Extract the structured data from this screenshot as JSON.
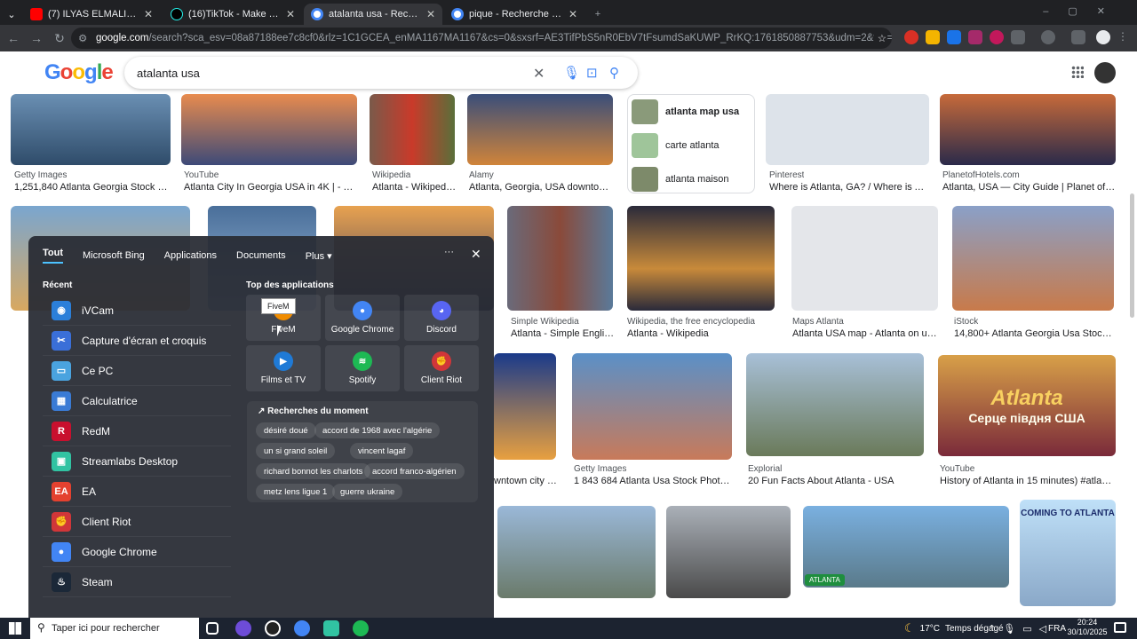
{
  "browser": {
    "tabs": [
      {
        "title": "(7) ILYAS ELMALIKI - 29 / Octob",
        "color": "#ff0000"
      },
      {
        "title": "(16)TikTok - Make Your Day",
        "color": "#000000"
      },
      {
        "title": "atalanta usa - Recherche Googl",
        "color": "#4285f4"
      },
      {
        "title": "pique - Recherche Google",
        "color": "#4285f4"
      }
    ],
    "url_host": "google.com",
    "url_rest": "/search?sca_esv=08a87188ee7c8cf0&rlz=1C1GCEA_enMA1167MA1167&cs=0&sxsrf=AE3TifPbS5nR0EbV7tFsumdSaKUWP_RrKQ:1761850887753&udm=2&fbs=AIIjpHx4nJjfGojPVHhEACUHPiMQ_pbg..."
  },
  "google": {
    "query": "atalanta usa",
    "related": [
      "atlanta map usa",
      "carte atlanta",
      "atlanta maison"
    ],
    "results": [
      {
        "src": "Getty Images",
        "title": "1,251,840 Atlanta Georgia Stock Phot..."
      },
      {
        "src": "YouTube",
        "title": "Atlanta City In Georgia USA in 4K | - Yo..."
      },
      {
        "src": "Wikipedia",
        "title": "Atlanta - Wikipedia..."
      },
      {
        "src": "Alamy",
        "title": "Atlanta, Georgia, USA downtown ci..."
      },
      {
        "src": "Pinterest",
        "title": "Where is Atlanta, GA? / Where is Atlan..."
      },
      {
        "src": "PlanetofHotels.com",
        "title": "Atlanta, USA — City Guide | Planet of Hotels"
      },
      {
        "src": "Simple Wikipedia",
        "title": "Atlanta - Simple English..."
      },
      {
        "src": "Wikipedia, the free encyclopedia",
        "title": "Atlanta - Wikipedia"
      },
      {
        "src": "Maps Atlanta",
        "title": "Atlanta USA map - Atlanta on us ma..."
      },
      {
        "src": "iStock",
        "title": "14,800+ Atlanta Georgia Usa Stock Ph..."
      },
      {
        "src": "Getty Images",
        "title": "1 843 684 Atlanta Usa Stock Photos, Hi..."
      },
      {
        "src": "Explorial",
        "title": "20 Fun Facts About Atlanta - USA"
      },
      {
        "src": "YouTube",
        "title": "History of Atlanta in 15 minutes) #atlanta #..."
      },
      {
        "src": "",
        "title": "wntown city sk..."
      }
    ],
    "atlanta_badge": "ATLANTA",
    "thumb_text_1": "Atlanta",
    "thumb_text_2": "Серце півдня США",
    "thumb_text_3": "COMING TO ATLANTA"
  },
  "startmenu": {
    "tabs": [
      "Tout",
      "Microsoft Bing",
      "Applications",
      "Documents",
      "Plus"
    ],
    "recent_heading": "Récent",
    "recent": [
      {
        "label": "iVCam",
        "color": "#2b7fd9",
        "glyph": "◉"
      },
      {
        "label": "Capture d'écran et croquis",
        "color": "#3a6fd8",
        "glyph": "✂"
      },
      {
        "label": "Ce PC",
        "color": "#4aa3df",
        "glyph": "▭"
      },
      {
        "label": "Calculatrice",
        "color": "#3a7bd5",
        "glyph": "▦"
      },
      {
        "label": "RedM",
        "color": "#c8102e",
        "glyph": "R"
      },
      {
        "label": "Streamlabs Desktop",
        "color": "#31c3a2",
        "glyph": "▣"
      },
      {
        "label": "EA",
        "color": "#e4412f",
        "glyph": "EA"
      },
      {
        "label": "Client Riot",
        "color": "#d13639",
        "glyph": "✊"
      },
      {
        "label": "Google Chrome",
        "color": "#4285f4",
        "glyph": "●"
      },
      {
        "label": "Steam",
        "color": "#1b2838",
        "glyph": "♨"
      }
    ],
    "top_heading": "Top des applications",
    "apps": [
      {
        "label": "FiveM",
        "color": "#f08c00",
        "glyph": "F"
      },
      {
        "label": "Google Chrome",
        "color": "#4285f4",
        "glyph": "●"
      },
      {
        "label": "Discord",
        "color": "#5865f2",
        "glyph": "◕"
      },
      {
        "label": "Films et TV",
        "color": "#1f7ad6",
        "glyph": "▶"
      },
      {
        "label": "Spotify",
        "color": "#1db954",
        "glyph": "≋"
      },
      {
        "label": "Client Riot",
        "color": "#d13639",
        "glyph": "✊"
      }
    ],
    "tooltip": "FiveM",
    "trending_heading": "Recherches du moment",
    "trending": [
      "désiré doué",
      "accord de 1968 avec l'algérie",
      "un si grand soleil",
      "vincent lagaf",
      "richard bonnot les charlots",
      "accord franco-algérien",
      "metz lens ligue 1",
      "guerre ukraine"
    ]
  },
  "taskbar": {
    "search_placeholder": "Taper ici pour rechercher",
    "temp": "17°C",
    "weather": "Temps dégagé",
    "lang": "FRA",
    "time": "20:24",
    "date": "30/10/2025"
  }
}
